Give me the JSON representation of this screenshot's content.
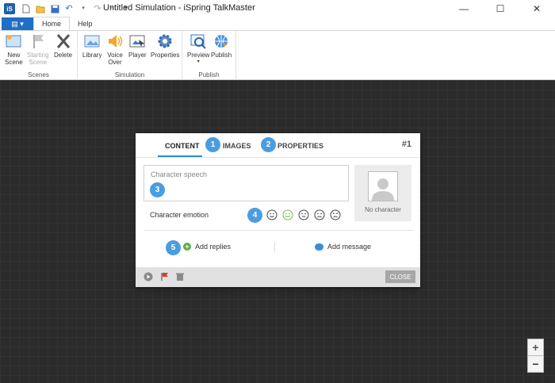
{
  "window": {
    "title": "Untitled Simulation - iSpring TalkMaster",
    "app_icon": "iSpring",
    "controls": {
      "minimize": "—",
      "maximize": "☐",
      "close": "✕"
    }
  },
  "ribbon_tabs": {
    "file": "▤ ▾",
    "home": "Home",
    "help": "Help"
  },
  "ribbon": {
    "groups": {
      "scenes": "Scenes",
      "simulation": "Simulation",
      "publish": "Publish"
    },
    "buttons": {
      "new_scene": "New\nScene",
      "starting_scene": "Starting\nScene",
      "delete": "Delete",
      "library": "Library",
      "voice_over": "Voice\nOver",
      "player": "Player",
      "properties": "Properties",
      "preview": "Preview",
      "publish": "Publish"
    }
  },
  "dialog": {
    "tabs": {
      "content": "CONTENT",
      "images": "IMAGES",
      "properties": "PROPERTIES"
    },
    "index": "#1",
    "badges": [
      "1",
      "2",
      "3",
      "4",
      "5"
    ],
    "speech_placeholder": "Character speech",
    "no_character": "No character",
    "emotion_label": "Character emotion",
    "add_replies": "Add replies",
    "add_message": "Add message",
    "close": "CLOSE"
  },
  "zoom": {
    "in": "+",
    "out": "−"
  },
  "colors": {
    "accent": "#4a9de0",
    "file_tab": "#1f6fc5",
    "canvas": "#2b2b2b",
    "reply_green": "#5aae4b"
  }
}
